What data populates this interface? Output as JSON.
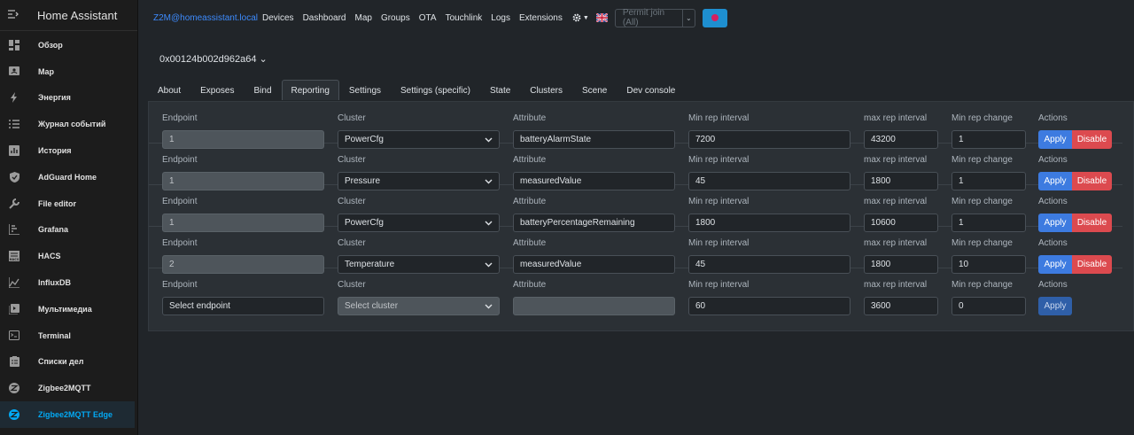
{
  "sidebar": {
    "title": "Home Assistant",
    "items": [
      {
        "label": "Обзор",
        "icon": "dashboard-icon"
      },
      {
        "label": "Map",
        "icon": "map-icon"
      },
      {
        "label": "Энергия",
        "icon": "lightning-icon"
      },
      {
        "label": "Журнал событий",
        "icon": "list-icon"
      },
      {
        "label": "История",
        "icon": "chart-icon"
      },
      {
        "label": "AdGuard Home",
        "icon": "shield-icon"
      },
      {
        "label": "File editor",
        "icon": "wrench-icon"
      },
      {
        "label": "Grafana",
        "icon": "graph-icon"
      },
      {
        "label": "HACS",
        "icon": "hacs-icon"
      },
      {
        "label": "InfluxDB",
        "icon": "line-chart-icon"
      },
      {
        "label": "Мультимедиа",
        "icon": "play-icon"
      },
      {
        "label": "Terminal",
        "icon": "terminal-icon"
      },
      {
        "label": "Списки дел",
        "icon": "clipboard-icon"
      },
      {
        "label": "Zigbee2MQTT",
        "icon": "zigbee-icon"
      },
      {
        "label": "Zigbee2MQTT Edge",
        "icon": "zigbee-icon",
        "active": true
      }
    ]
  },
  "topnav": {
    "brand": "Z2M@homeassistant.local",
    "links": [
      "Devices",
      "Dashboard",
      "Map",
      "Groups",
      "OTA",
      "Touchlink",
      "Logs",
      "Extensions"
    ],
    "permit_join": "Permit join (All)"
  },
  "device": {
    "title": "0x00124b002d962a64 ⌄"
  },
  "tabs": [
    "About",
    "Exposes",
    "Bind",
    "Reporting",
    "Settings",
    "Settings (specific)",
    "State",
    "Clusters",
    "Scene",
    "Dev console"
  ],
  "active_tab": "Reporting",
  "labels": {
    "endpoint": "Endpoint",
    "cluster": "Cluster",
    "attribute": "Attribute",
    "min_rep_interval": "Min rep interval",
    "max_rep_interval": "max rep interval",
    "min_rep_change": "Min rep change",
    "actions": "Actions",
    "apply": "Apply",
    "disable": "Disable"
  },
  "rows": [
    {
      "endpoint": "1",
      "cluster": "PowerCfg",
      "attribute": "batteryAlarmState",
      "min": "7200",
      "max": "43200",
      "change": "1"
    },
    {
      "endpoint": "1",
      "cluster": "Pressure",
      "attribute": "measuredValue",
      "min": "45",
      "max": "1800",
      "change": "1"
    },
    {
      "endpoint": "1",
      "cluster": "PowerCfg",
      "attribute": "batteryPercentageRemaining",
      "min": "1800",
      "max": "10600",
      "change": "1"
    },
    {
      "endpoint": "2",
      "cluster": "Temperature",
      "attribute": "measuredValue",
      "min": "45",
      "max": "1800",
      "change": "10"
    }
  ],
  "new_row": {
    "endpoint": "Select endpoint",
    "cluster": "Select cluster",
    "attribute": "",
    "min": "60",
    "max": "3600",
    "change": "0"
  },
  "colors": {
    "accent": "#03a9f4",
    "apply": "#3d7be0",
    "disable": "#dc4a4f"
  }
}
